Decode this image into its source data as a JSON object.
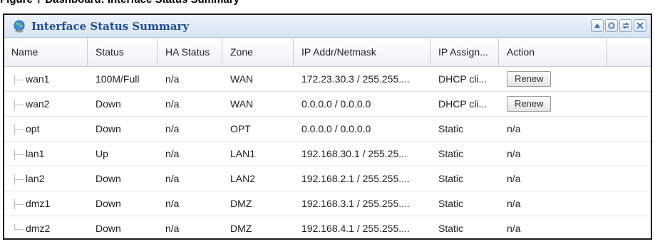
{
  "caption": "Figure ? Dashboard: Interface Status Summary",
  "widget": {
    "title": "Interface Status Summary",
    "icon": "globe-icon",
    "controls": [
      "collapse-icon",
      "settings-icon",
      "refresh-icon",
      "close-icon"
    ]
  },
  "table": {
    "headers": [
      "Name",
      "Status",
      "HA Status",
      "Zone",
      "IP Addr/Netmask",
      "IP Assign...",
      "Action"
    ],
    "rows": [
      {
        "name": "wan1",
        "status": "100M/Full",
        "ha": "n/a",
        "zone": "WAN",
        "ip": "172.23.30.3 / 255.255....",
        "assign": "DHCP cli...",
        "action": "Renew",
        "action_is_button": true
      },
      {
        "name": "wan2",
        "status": "Down",
        "ha": "n/a",
        "zone": "WAN",
        "ip": "0.0.0.0 / 0.0.0.0",
        "assign": "DHCP cli...",
        "action": "Renew",
        "action_is_button": true
      },
      {
        "name": "opt",
        "status": "Down",
        "ha": "n/a",
        "zone": "OPT",
        "ip": "0.0.0.0 / 0.0.0.0",
        "assign": "Static",
        "action": "n/a",
        "action_is_button": false
      },
      {
        "name": "lan1",
        "status": "Up",
        "ha": "n/a",
        "zone": "LAN1",
        "ip": "192.168.30.1 / 255.25...",
        "assign": "Static",
        "action": "n/a",
        "action_is_button": false
      },
      {
        "name": "lan2",
        "status": "Down",
        "ha": "n/a",
        "zone": "LAN2",
        "ip": "192.168.2.1 / 255.255....",
        "assign": "Static",
        "action": "n/a",
        "action_is_button": false
      },
      {
        "name": "dmz1",
        "status": "Down",
        "ha": "n/a",
        "zone": "DMZ",
        "ip": "192.168.3.1 / 255.255....",
        "assign": "Static",
        "action": "n/a",
        "action_is_button": false
      },
      {
        "name": "dmz2",
        "status": "Down",
        "ha": "n/a",
        "zone": "DMZ",
        "ip": "192.168.4.1 / 255.255....",
        "assign": "Static",
        "action": "n/a",
        "action_is_button": false
      }
    ]
  }
}
